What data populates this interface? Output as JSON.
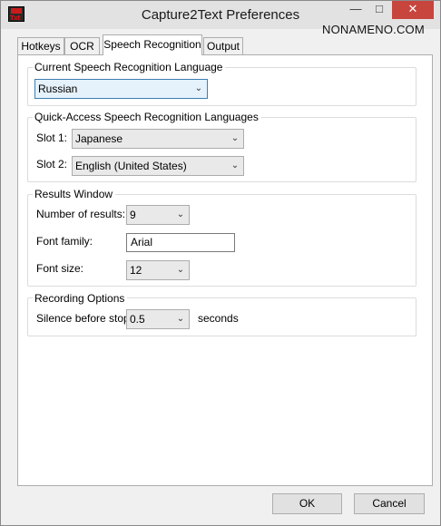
{
  "window": {
    "title": "Capture2Text Preferences",
    "app_icon_text": "Txt",
    "minimize_glyph": "—",
    "maximize_glyph": "□",
    "close_glyph": "✕"
  },
  "overlay_text": "NONAMENO.COM",
  "tabs": [
    {
      "label": "Hotkeys"
    },
    {
      "label": "OCR"
    },
    {
      "label": "Speech Recognition",
      "active": true
    },
    {
      "label": "Output"
    }
  ],
  "current_language": {
    "group_label": "Current Speech Recognition Language",
    "value": "Russian"
  },
  "quick_access": {
    "group_label": "Quick-Access Speech Recognition Languages",
    "slot1_label": "Slot 1:",
    "slot1_value": "Japanese",
    "slot2_label": "Slot 2:",
    "slot2_value": "English (United States)"
  },
  "results_window": {
    "group_label": "Results Window",
    "num_results_label": "Number of results:",
    "num_results_value": "9",
    "font_family_label": "Font family:",
    "font_family_value": "Arial",
    "font_size_label": "Font size:",
    "font_size_value": "12"
  },
  "recording": {
    "group_label": "Recording Options",
    "silence_label": "Silence before stop:",
    "silence_value": "0.5",
    "silence_unit": "seconds"
  },
  "buttons": {
    "ok": "OK",
    "cancel": "Cancel"
  }
}
